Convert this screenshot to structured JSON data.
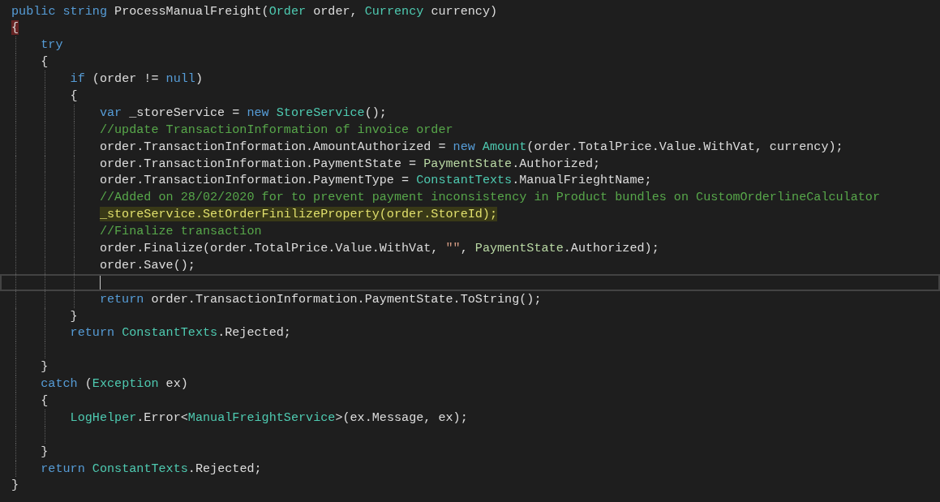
{
  "editor": {
    "lines": [
      {
        "current": false,
        "tokens": [
          {
            "kind": "keyword",
            "text": "public string"
          },
          {
            "kind": "plain",
            "text": " ProcessManualFreight("
          },
          {
            "kind": "type",
            "text": "Order"
          },
          {
            "kind": "plain",
            "text": " order, "
          },
          {
            "kind": "type",
            "text": "Currency"
          },
          {
            "kind": "plain",
            "text": " currency)"
          }
        ]
      },
      {
        "current": false,
        "tokens": [
          {
            "kind": "match",
            "text": "{"
          }
        ],
        "children": [
          {
            "current": false,
            "tokens": [
              {
                "kind": "keyword",
                "text": "try"
              }
            ]
          },
          {
            "current": false,
            "tokens": [
              {
                "kind": "plain",
                "text": "{"
              }
            ],
            "children": [
              {
                "current": false,
                "tokens": [
                  {
                    "kind": "keyword",
                    "text": "if"
                  },
                  {
                    "kind": "plain",
                    "text": " (order != "
                  },
                  {
                    "kind": "keyword",
                    "text": "null"
                  },
                  {
                    "kind": "plain",
                    "text": ")"
                  }
                ]
              },
              {
                "current": false,
                "tokens": [
                  {
                    "kind": "plain",
                    "text": "{"
                  }
                ],
                "children": [
                  {
                    "current": false,
                    "tokens": [
                      {
                        "kind": "keyword",
                        "text": "var"
                      },
                      {
                        "kind": "plain",
                        "text": " _storeService = "
                      },
                      {
                        "kind": "keyword",
                        "text": "new"
                      },
                      {
                        "kind": "type",
                        "text": " StoreService"
                      },
                      {
                        "kind": "plain",
                        "text": "();"
                      }
                    ]
                  },
                  {
                    "current": false,
                    "tokens": [
                      {
                        "kind": "comment",
                        "text": "//update TransactionInformation of invoice order"
                      }
                    ]
                  },
                  {
                    "current": false,
                    "tokens": [
                      {
                        "kind": "plain",
                        "text": "order.TransactionInformation.AmountAuthorized = "
                      },
                      {
                        "kind": "keyword",
                        "text": "new"
                      },
                      {
                        "kind": "type",
                        "text": " Amount"
                      },
                      {
                        "kind": "plain",
                        "text": "(order.TotalPrice.Value.WithVat, currency);"
                      }
                    ]
                  },
                  {
                    "current": false,
                    "tokens": [
                      {
                        "kind": "plain",
                        "text": "order.TransactionInformation.PaymentState = "
                      },
                      {
                        "kind": "enum",
                        "text": "PaymentState"
                      },
                      {
                        "kind": "plain",
                        "text": ".Authorized;"
                      }
                    ]
                  },
                  {
                    "current": false,
                    "tokens": [
                      {
                        "kind": "plain",
                        "text": "order.TransactionInformation.PaymentType = "
                      },
                      {
                        "kind": "type",
                        "text": "ConstantTexts"
                      },
                      {
                        "kind": "plain",
                        "text": ".ManualFrieghtName;"
                      }
                    ]
                  },
                  {
                    "current": false,
                    "tokens": [
                      {
                        "kind": "comment",
                        "text": "//Added on 28/02/2020 for to prevent payment inconsistency in Product bundles on CustomOrderlineCalculator"
                      }
                    ]
                  },
                  {
                    "current": false,
                    "tokens": [
                      {
                        "kind": "highlight",
                        "text": "_storeService.SetOrderFinilizeProperty(order.StoreId);"
                      }
                    ]
                  },
                  {
                    "current": false,
                    "tokens": [
                      {
                        "kind": "comment",
                        "text": "//Finalize transaction"
                      }
                    ]
                  },
                  {
                    "current": false,
                    "tokens": [
                      {
                        "kind": "plain",
                        "text": "order.Finalize(order.TotalPrice.Value.WithVat, "
                      },
                      {
                        "kind": "string",
                        "text": "\"\""
                      },
                      {
                        "kind": "plain",
                        "text": ", "
                      },
                      {
                        "kind": "enum",
                        "text": "PaymentState"
                      },
                      {
                        "kind": "plain",
                        "text": ".Authorized);"
                      }
                    ]
                  },
                  {
                    "current": false,
                    "tokens": [
                      {
                        "kind": "plain",
                        "text": "order.Save();"
                      }
                    ]
                  },
                  {
                    "current": true
                  },
                  {
                    "current": false,
                    "tokens": [
                      {
                        "kind": "keyword",
                        "text": "return"
                      },
                      {
                        "kind": "plain",
                        "text": " order.TransactionInformation.PaymentState.ToString();"
                      }
                    ]
                  }
                ]
              },
              {
                "current": false,
                "tokens": [
                  {
                    "kind": "plain",
                    "text": "}"
                  }
                ]
              },
              {
                "current": false,
                "tokens": [
                  {
                    "kind": "keyword",
                    "text": "return"
                  },
                  {
                    "kind": "type",
                    "text": " ConstantTexts"
                  },
                  {
                    "kind": "plain",
                    "text": ".Rejected;"
                  }
                ]
              },
              {
                "current": false
              }
            ]
          },
          {
            "current": false,
            "tokens": [
              {
                "kind": "plain",
                "text": "}"
              }
            ]
          },
          {
            "current": false,
            "tokens": [
              {
                "kind": "keyword",
                "text": "catch"
              },
              {
                "kind": "plain",
                "text": " ("
              },
              {
                "kind": "type",
                "text": "Exception"
              },
              {
                "kind": "plain",
                "text": " ex)"
              }
            ]
          },
          {
            "current": false,
            "tokens": [
              {
                "kind": "plain",
                "text": "{"
              }
            ],
            "children": [
              {
                "current": false,
                "tokens": [
                  {
                    "kind": "type",
                    "text": "LogHelper"
                  },
                  {
                    "kind": "plain",
                    "text": ".Error<"
                  },
                  {
                    "kind": "type",
                    "text": "ManualFreightService"
                  },
                  {
                    "kind": "plain",
                    "text": ">(ex.Message, ex);"
                  }
                ]
              },
              {
                "current": false
              }
            ]
          },
          {
            "current": false,
            "tokens": [
              {
                "kind": "plain",
                "text": "}"
              }
            ]
          },
          {
            "current": false,
            "tokens": [
              {
                "kind": "keyword",
                "text": "return"
              },
              {
                "kind": "type",
                "text": " ConstantTexts"
              },
              {
                "kind": "plain",
                "text": ".Rejected;"
              }
            ]
          }
        ]
      },
      {
        "current": false,
        "tokens": [
          {
            "kind": "plain",
            "text": "}"
          }
        ]
      }
    ]
  }
}
